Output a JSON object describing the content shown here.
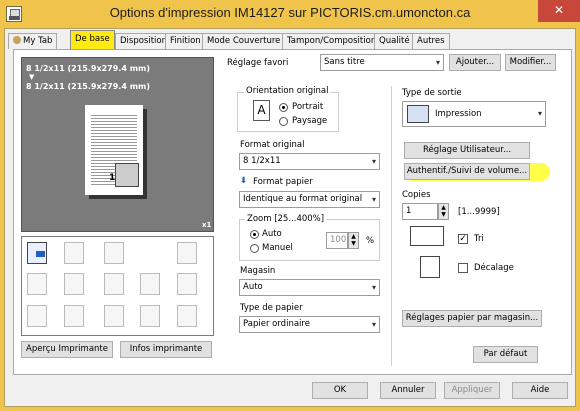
{
  "window": {
    "title": "Options d'impression IM14127 sur PICTORIS.cm.umoncton.ca",
    "close_label": "✕"
  },
  "tabs": [
    {
      "label": "My Tab"
    },
    {
      "label": "De base"
    },
    {
      "label": "Disposition"
    },
    {
      "label": "Finition"
    },
    {
      "label": "Mode Couverture"
    },
    {
      "label": "Tampon/Composition"
    },
    {
      "label": "Qualité"
    },
    {
      "label": "Autres"
    }
  ],
  "preview": {
    "line1": "8 1/2x11 (215.9x279.4 mm)",
    "arrow": "▼",
    "line2": "8 1/2x11 (215.9x279.4 mm)",
    "page_number": "1",
    "copies_badge": "x1"
  },
  "left_buttons": {
    "printer_view": "Aperçu Imprimante",
    "printer_info": "Infos imprimante"
  },
  "favorite": {
    "label": "Réglage favori",
    "value": "Sans titre",
    "add": "Ajouter...",
    "modify": "Modifier..."
  },
  "orientation": {
    "label": "Orientation original",
    "portrait": "Portrait",
    "landscape": "Paysage",
    "icon_letter": "A"
  },
  "format": {
    "label": "Format original",
    "value": "8 1/2x11",
    "paper_label": "Format papier",
    "paper_value": "Identique au format original"
  },
  "zoom": {
    "label": "Zoom [25...400%]",
    "auto": "Auto",
    "manual": "Manuel",
    "value": "100",
    "unit": "%"
  },
  "tray": {
    "label": "Magasin",
    "value": "Auto"
  },
  "paper_type": {
    "label": "Type de papier",
    "value": "Papier ordinaire"
  },
  "output": {
    "label": "Type de sortie",
    "value": "Impression"
  },
  "user_settings": "Réglage Utilisateur...",
  "auth": "Authentif./Suivi de volume...",
  "copies": {
    "label": "Copies",
    "value": "1",
    "range": "[1...9999]"
  },
  "collate": {
    "label": "Tri",
    "checked": "✓"
  },
  "offset": {
    "label": "Décalage"
  },
  "tray_paper_settings": "Réglages papier par magasin...",
  "default": "Par défaut",
  "bottom": {
    "ok": "OK",
    "cancel": "Annuler",
    "apply": "Appliquer",
    "help": "Aide"
  }
}
